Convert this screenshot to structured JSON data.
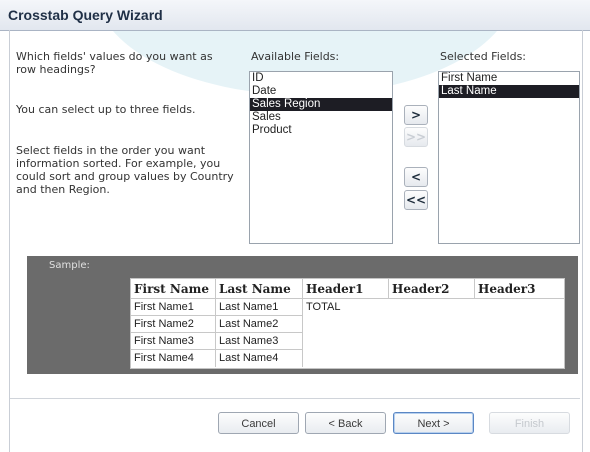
{
  "window": {
    "title": "Crosstab Query Wizard"
  },
  "prompt": {
    "question": "Which fields' values do you want as row headings?",
    "hint_limit": "You can select up to three fields.",
    "hint_order": "Select fields in the order you want information sorted. For example, you could sort and group values by Country and then Region."
  },
  "available": {
    "label": "Available Fields:",
    "items": [
      "ID",
      "Date",
      "Sales Region",
      "Sales",
      "Product"
    ],
    "selected_item": "Sales Region"
  },
  "selected": {
    "label": "Selected Fields:",
    "items": [
      "First Name",
      "Last Name"
    ],
    "selected_item": "Last Name"
  },
  "move_buttons": {
    "add_one": ">",
    "add_all": ">>",
    "remove_one": "<",
    "remove_all": "<<"
  },
  "sample": {
    "label": "Sample:",
    "headers": [
      "First Name",
      "Last Name",
      "Header1",
      "Header2",
      "Header3"
    ],
    "rows": [
      [
        "First Name1",
        "Last Name1"
      ],
      [
        "First Name2",
        "Last Name2"
      ],
      [
        "First Name3",
        "Last Name3"
      ],
      [
        "First Name4",
        "Last Name4"
      ]
    ],
    "total_label": "TOTAL"
  },
  "footer": {
    "cancel": "Cancel",
    "back": "< Back",
    "next": "Next >",
    "finish": "Finish"
  },
  "colors": {
    "selected_row_bg": "#1d1d24",
    "sample_panel_bg": "#6b6b6b",
    "title_text": "#1f2f46"
  }
}
